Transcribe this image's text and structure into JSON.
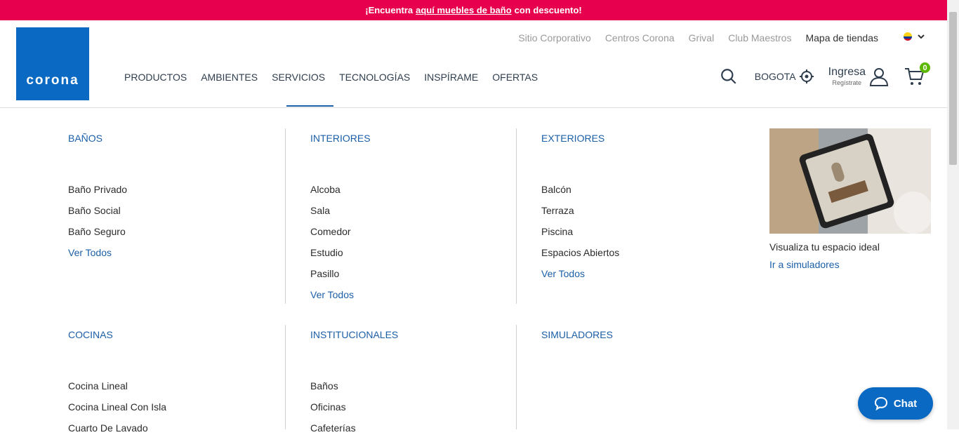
{
  "promo_bar": {
    "prefix": "¡Encuentra",
    "link": "aquí muebles de baño",
    "suffix": "con descuento!"
  },
  "logo": {
    "text": "corona"
  },
  "utility_nav": [
    "Sitio Corporativo",
    "Centros Corona",
    "Grival",
    "Club Maestros",
    "Mapa de tiendas"
  ],
  "main_nav": [
    "PRODUCTOS",
    "AMBIENTES",
    "SERVICIOS",
    "TECNOLOGÍAS",
    "INSPÍRAME",
    "OFERTAS"
  ],
  "location": {
    "label": "BOGOTA"
  },
  "account": {
    "label": "Ingresa",
    "sublabel": "Regístrate"
  },
  "cart": {
    "count": "0"
  },
  "menu": {
    "banos": {
      "title": "BAÑOS",
      "items": [
        "Baño Privado",
        "Baño Social",
        "Baño Seguro"
      ],
      "view_all": "Ver Todos"
    },
    "interiores": {
      "title": "INTERIORES",
      "items": [
        "Alcoba",
        "Sala",
        "Comedor",
        "Estudio",
        "Pasillo"
      ],
      "view_all": "Ver Todos"
    },
    "exteriores": {
      "title": "EXTERIORES",
      "items": [
        "Balcón",
        "Terraza",
        "Piscina",
        "Espacios Abiertos"
      ],
      "view_all": "Ver Todos"
    },
    "cocinas": {
      "title": "COCINAS",
      "items": [
        "Cocina Lineal",
        "Cocina Lineal Con Isla",
        "Cuarto De Lavado"
      ]
    },
    "institucionales": {
      "title": "INSTITUCIONALES",
      "items": [
        "Baños",
        "Oficinas",
        "Cafeterías"
      ]
    },
    "simuladores": {
      "title": "SIMULADORES"
    }
  },
  "promo_card": {
    "caption": "Visualiza tu espacio ideal",
    "cta": "Ir a simuladores"
  },
  "chat": {
    "label": "Chat"
  },
  "colors": {
    "promo_bar": "#e6004e",
    "brand_blue": "#0a69c2",
    "link_blue": "#1b5fa7",
    "badge_green": "#5cb800"
  }
}
